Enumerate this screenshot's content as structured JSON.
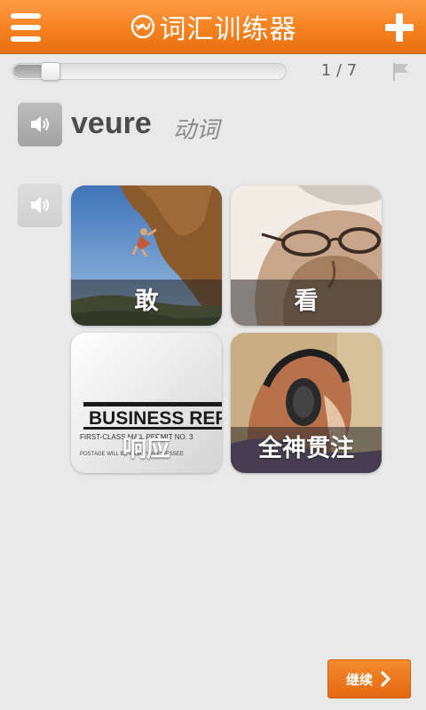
{
  "header": {
    "title": "词汇训练器",
    "icons": {
      "menu": "menu-icon",
      "add": "plus-icon",
      "logo": "logo-icon"
    },
    "color": "#f5821f"
  },
  "progress": {
    "counter": "1 / 7",
    "fraction": 0.14
  },
  "word": {
    "text": "veure",
    "type": "动词"
  },
  "options": [
    {
      "label": "敢"
    },
    {
      "label": "看"
    },
    {
      "label": "响应",
      "image_text": [
        "BUSINESS REP",
        "FIRST-CLASS MAIL   PERMIT NO. 3",
        "POSTAGE WILL BE PAID BY ADDRESSEE"
      ]
    },
    {
      "label": "全神贯注"
    }
  ],
  "footer": {
    "next_label": "继续",
    "accent": "#ef7b22"
  }
}
